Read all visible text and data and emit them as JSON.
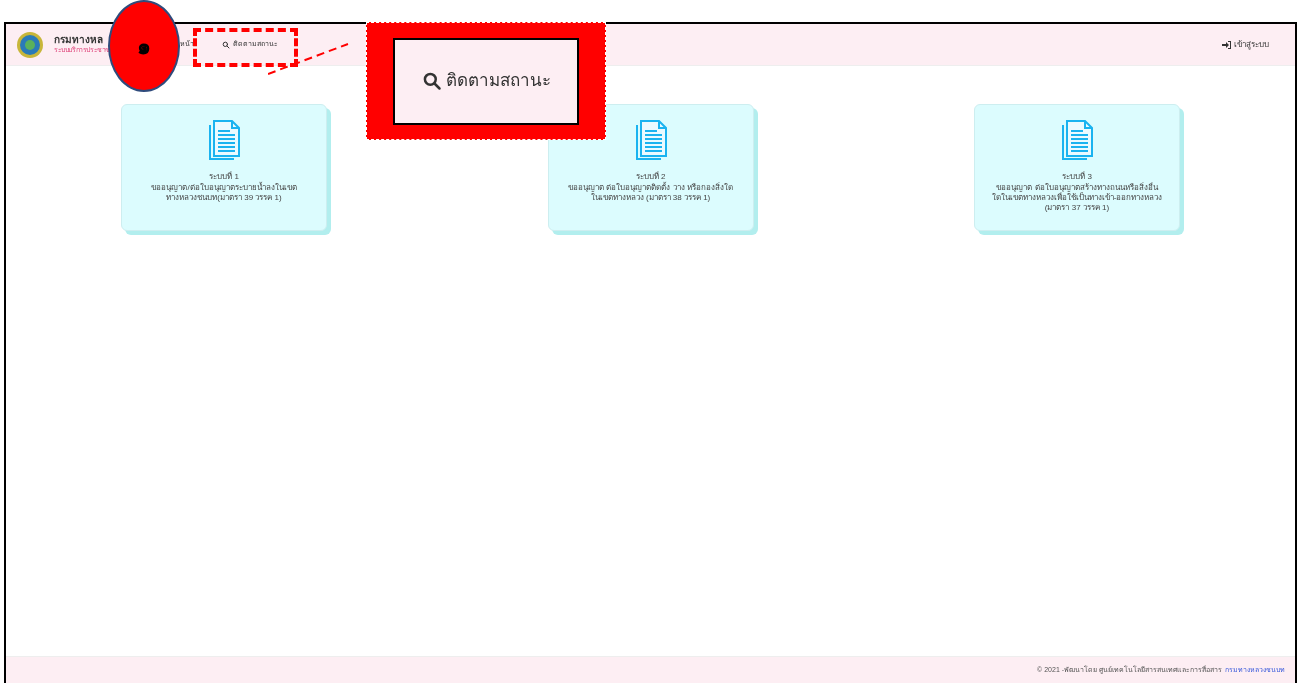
{
  "header": {
    "title": "กรมทางหล",
    "subtitle": "ระบบบริการประชาช",
    "nav": [
      {
        "label": "หน้า",
        "icon": false
      },
      {
        "label": "ติดตามสถานะ",
        "icon": true
      }
    ],
    "login": "เข้าสู่ระบบ"
  },
  "cards": [
    {
      "title": "ระบบที่ 1",
      "lines": [
        "ขออนุญาต/ต่อใบอนุญาตระบายน้ำลงในเขต",
        "ทางหลวงชนบท(มาตรา 39 วรรค 1)"
      ]
    },
    {
      "title": "ระบบที่ 2",
      "lines": [
        "ขออนุญาต ต่อใบอนุญาตติดตั้ง วาง หรือกองสิ่งใด",
        "ในเขตทางหลวง (มาตรา 38 วรรค 1)"
      ]
    },
    {
      "title": "ระบบที่ 3",
      "lines": [
        "ขออนุญาต ต่อใบอนุญาตสร้างทางถนนหรือสิ่งอื่น",
        "ใดในเขตทางหลวงเพื่อใช้เป็นทางเข้า-ออกทางหลวง",
        "(มาตรา 37 วรรค 1)"
      ]
    }
  ],
  "footer": {
    "text": "© 2021 -พัฒนาโดย ศูนย์เทคโนโลยีสารสนเทศและการสื่อสาร",
    "link": "กรมทางหลวงชนบท"
  },
  "annotations": {
    "marker": "๑",
    "callout": "ติดตามสถานะ"
  }
}
